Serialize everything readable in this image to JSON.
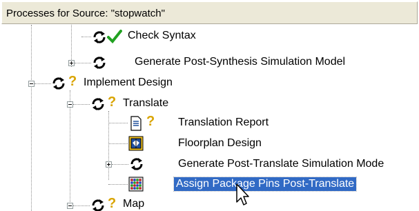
{
  "header": {
    "title": "Processes for Source:  \"stopwatch\""
  },
  "items": [
    {
      "label": "Check Syntax",
      "status": "ok"
    },
    {
      "label": "Generate Post-Synthesis Simulation Model",
      "status": "none"
    },
    {
      "label": "Implement Design",
      "status": "warning"
    },
    {
      "label": "Translate",
      "status": "warning"
    },
    {
      "label": "Translation Report",
      "status": "warning"
    },
    {
      "label": "Floorplan Design",
      "status": "none"
    },
    {
      "label": "Generate Post-Translate Simulation Mode",
      "status": "none"
    },
    {
      "label": "Assign Package Pins Post-Translate",
      "status": "selected"
    },
    {
      "label": "Map",
      "status": "warning"
    }
  ],
  "colors": {
    "selection": "#316ac5",
    "check": "#21a121",
    "question": "#d9a400"
  }
}
